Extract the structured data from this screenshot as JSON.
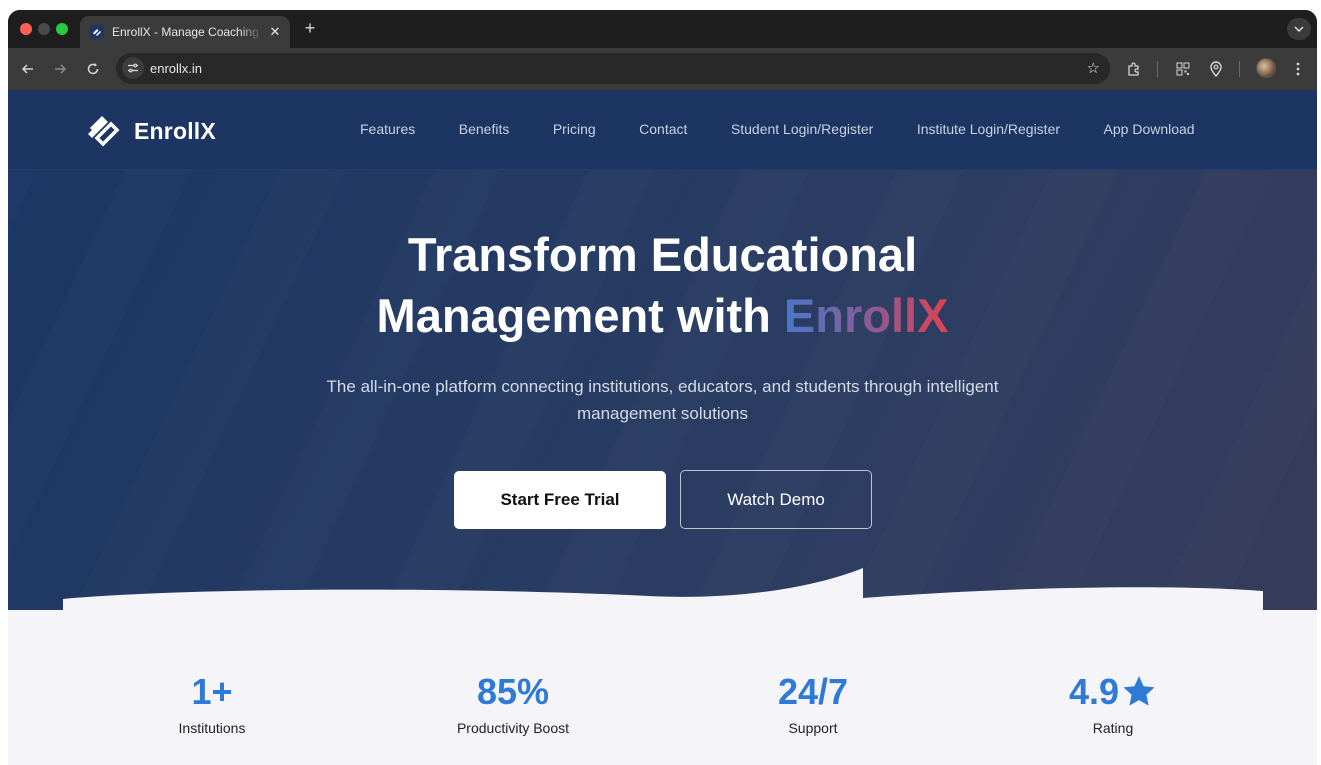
{
  "browser": {
    "tab_title": "EnrollX - Manage Coaching In",
    "url": "enrollx.in"
  },
  "site": {
    "brand": "EnrollX",
    "nav": [
      "Features",
      "Benefits",
      "Pricing",
      "Contact",
      "Student Login/Register",
      "Institute Login/Register",
      "App Download"
    ]
  },
  "hero": {
    "title_line1": "Transform Educational",
    "title_line2_prefix": "Management with ",
    "title_brand": "EnrollX",
    "subtitle": "The all-in-one platform connecting institutions, educators, and students through intelligent management solutions",
    "primary_cta": "Start Free Trial",
    "secondary_cta": "Watch Demo"
  },
  "stats": [
    {
      "value": "1+",
      "label": "Institutions"
    },
    {
      "value": "85%",
      "label": "Productivity Boost"
    },
    {
      "value": "24/7",
      "label": "Support"
    },
    {
      "value": "4.9",
      "label": "Rating"
    }
  ],
  "colors": {
    "nav_bg": "#1c3563",
    "stat_accent": "#2e7ad6",
    "brand_gradient_start": "#4a77c9",
    "brand_gradient_end": "#e0424f"
  },
  "icons": [
    "back-arrow-icon",
    "forward-arrow-icon",
    "reload-icon",
    "site-settings-icon",
    "bookmark-star-icon",
    "extensions-icon",
    "qr-code-icon",
    "location-pin-icon",
    "menu-kebab-icon",
    "star-icon"
  ]
}
